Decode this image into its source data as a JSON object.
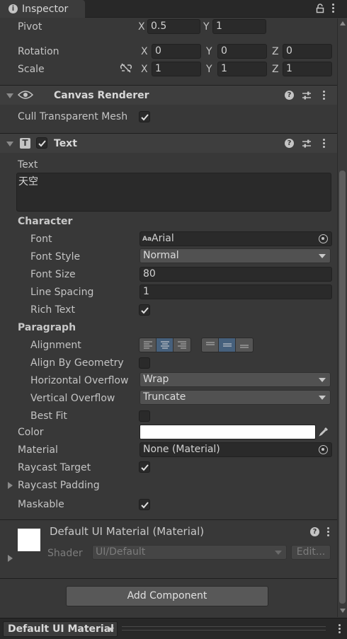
{
  "window": {
    "tab_label": "Inspector"
  },
  "transform": {
    "pivot_label": "Pivot",
    "pivot_x": "0.5",
    "pivot_y": "1",
    "rotation_label": "Rotation",
    "rotation_x": "0",
    "rotation_y": "0",
    "rotation_z": "0",
    "scale_label": "Scale",
    "scale_x": "1",
    "scale_y": "1",
    "scale_z": "1",
    "axis_x": "X",
    "axis_y": "Y",
    "axis_z": "Z"
  },
  "canvas_renderer": {
    "title": "Canvas Renderer",
    "cull_label": "Cull Transparent Mesh",
    "cull_checked": true
  },
  "text_component": {
    "title": "Text",
    "enabled": true,
    "text_label": "Text",
    "text_value": "天空",
    "character_header": "Character",
    "font_label": "Font",
    "font_value": "Arial",
    "font_icon_text": "Aa",
    "font_style_label": "Font Style",
    "font_style_value": "Normal",
    "font_size_label": "Font Size",
    "font_size_value": "80",
    "line_spacing_label": "Line Spacing",
    "line_spacing_value": "1",
    "rich_text_label": "Rich Text",
    "rich_text_checked": true,
    "paragraph_header": "Paragraph",
    "alignment_label": "Alignment",
    "horizontal_alignment_selected": "center",
    "vertical_alignment_selected": "middle",
    "align_geometry_label": "Align By Geometry",
    "align_geometry_checked": false,
    "h_overflow_label": "Horizontal Overflow",
    "h_overflow_value": "Wrap",
    "v_overflow_label": "Vertical Overflow",
    "v_overflow_value": "Truncate",
    "best_fit_label": "Best Fit",
    "best_fit_checked": false,
    "color_label": "Color",
    "color_value": "#ffffff",
    "material_label": "Material",
    "material_value": "None (Material)",
    "raycast_target_label": "Raycast Target",
    "raycast_target_checked": true,
    "raycast_padding_label": "Raycast Padding",
    "maskable_label": "Maskable",
    "maskable_checked": true
  },
  "material_preview": {
    "title": "Default UI Material (Material)",
    "shader_label": "Shader",
    "shader_value": "UI/Default",
    "edit_label": "Edit..."
  },
  "actions": {
    "add_component_label": "Add Component"
  },
  "footer": {
    "preview_label": "Default UI Material"
  },
  "colors": {
    "panel_bg": "#383838",
    "header_bg": "#3e3e3e",
    "field_bg": "#2a2a2a",
    "accent": "#46607c"
  }
}
